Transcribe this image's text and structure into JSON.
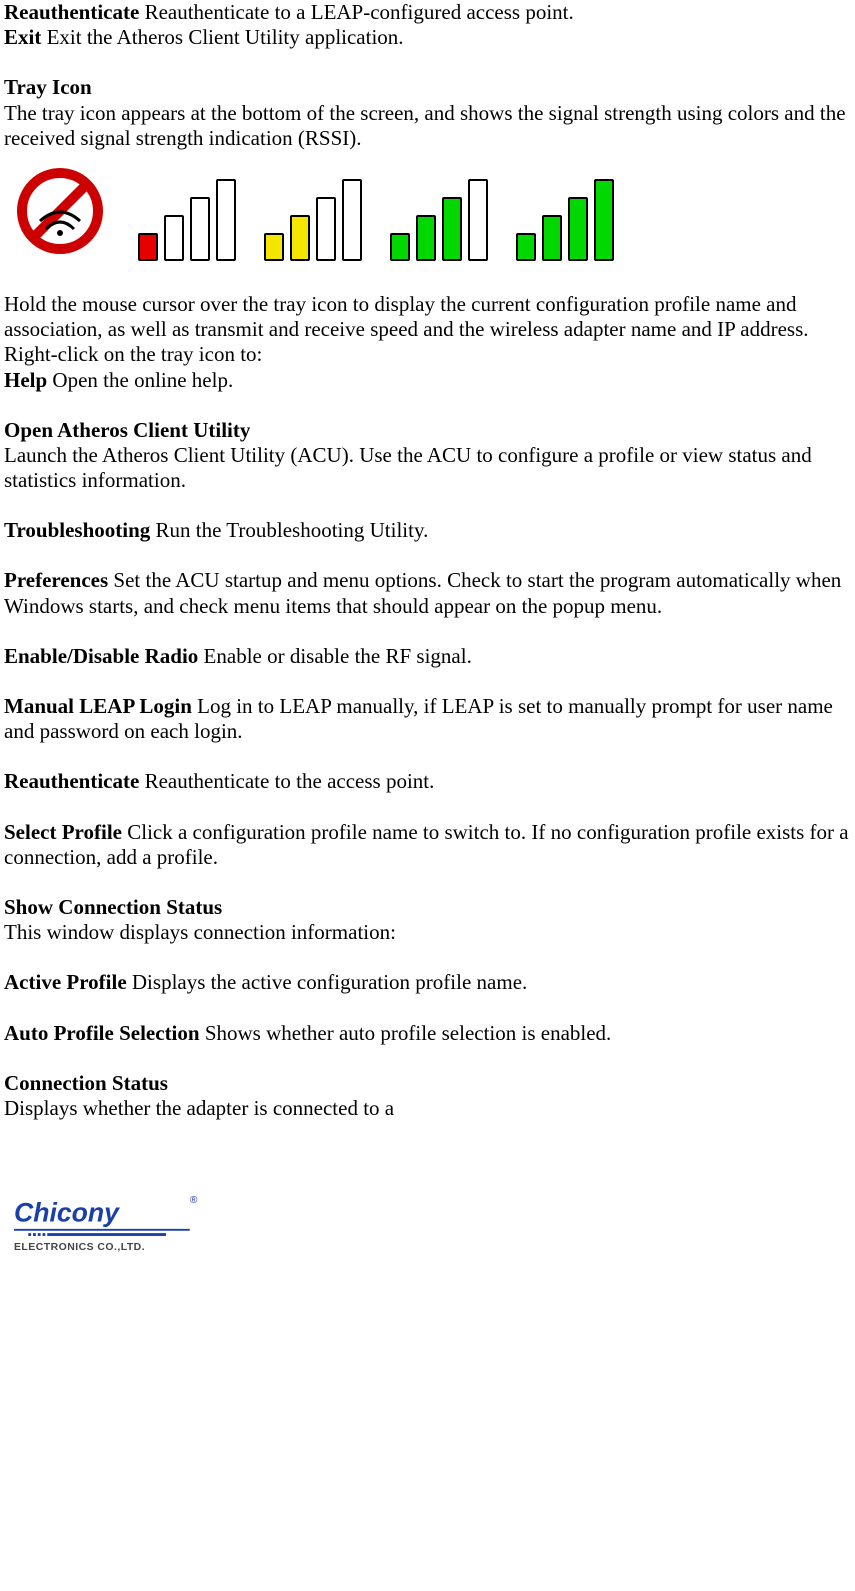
{
  "items": {
    "reauth1_label": "Reauthenticate",
    "reauth1_text": " Reauthenticate to a LEAP-configured access point.",
    "exit_label": "Exit",
    "exit_text": " Exit the Atheros Client Utility application.",
    "tray_icon_label": "Tray Icon",
    "tray_icon_text": "The tray icon appears at the bottom of the screen, and shows the signal strength using colors and the received signal strength indication (RSSI).",
    "hold_text": "Hold the mouse cursor over the tray icon to display the current configuration profile name and association, as well as transmit and receive speed and the wireless adapter name and IP address. Right-click on the tray icon to:",
    "help_label": "Help",
    "help_text": " Open the online help.",
    "open_acu_label": "Open Atheros Client Utility",
    "open_acu_text": "Launch the Atheros Client Utility (ACU). Use the ACU to configure a profile or view status and statistics information.",
    "troubleshoot_label": "Troubleshooting",
    "troubleshoot_text": " Run the Troubleshooting Utility.",
    "prefs_label": "Preferences",
    "prefs_text": " Set the ACU startup and menu options. Check to start the program automatically when Windows starts, and check menu items that should appear on the popup menu.",
    "radio_label": "Enable/Disable Radio",
    "radio_text": " Enable or disable the RF signal.",
    "leap_label": "Manual LEAP Login",
    "leap_text": " Log in to LEAP manually, if LEAP is set to manually prompt for user name and password on each login.",
    "reauth2_label": "Reauthenticate",
    "reauth2_text": " Reauthenticate to the access point.",
    "select_profile_label": "Select Profile",
    "select_profile_text": " Click a configuration profile name to switch to. If no configuration profile exists for a connection, add a profile.",
    "show_conn_label": "Show Connection Status",
    "show_conn_text": "This window displays connection information:",
    "active_profile_label": "Active Profile",
    "active_profile_text": " Displays the active configuration profile name.",
    "auto_profile_label": "Auto Profile Selection",
    "auto_profile_text": " Shows whether auto profile selection is enabled.",
    "conn_status_label": "Connection Status",
    "conn_status_text": "Displays whether the adapter is connected to a"
  },
  "logo": {
    "brand": "Chicony",
    "subtitle": "ELECTRONICS CO.,LTD."
  },
  "icons": {
    "no_signal": "no-signal-icon",
    "bars_red": "signal-bars-red-icon",
    "bars_yellow": "signal-bars-yellow-icon",
    "bars_green4": "signal-bars-green4-icon",
    "bars_green5": "signal-bars-green5-icon"
  }
}
